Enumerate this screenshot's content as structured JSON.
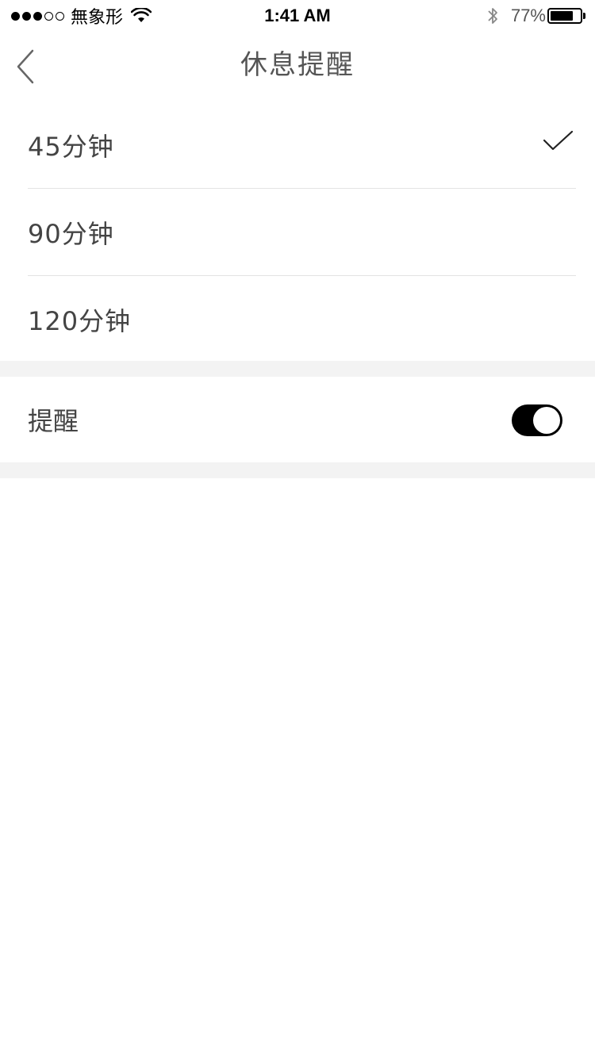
{
  "status_bar": {
    "carrier": "無象形",
    "time": "1:41 AM",
    "battery_percent": "77%",
    "battery_level": 0.77,
    "signal_strength": 3,
    "signal_max": 5
  },
  "nav": {
    "title": "休息提醒",
    "back_icon": "chevron-left-icon"
  },
  "options": [
    {
      "label": "45分钟",
      "selected": true
    },
    {
      "label": "90分钟",
      "selected": false
    },
    {
      "label": "120分钟",
      "selected": false
    }
  ],
  "reminder": {
    "label": "提醒",
    "enabled": true
  },
  "colors": {
    "separator_bg": "#f3f3f3",
    "toggle_on": "#000000",
    "text": "#444444"
  }
}
